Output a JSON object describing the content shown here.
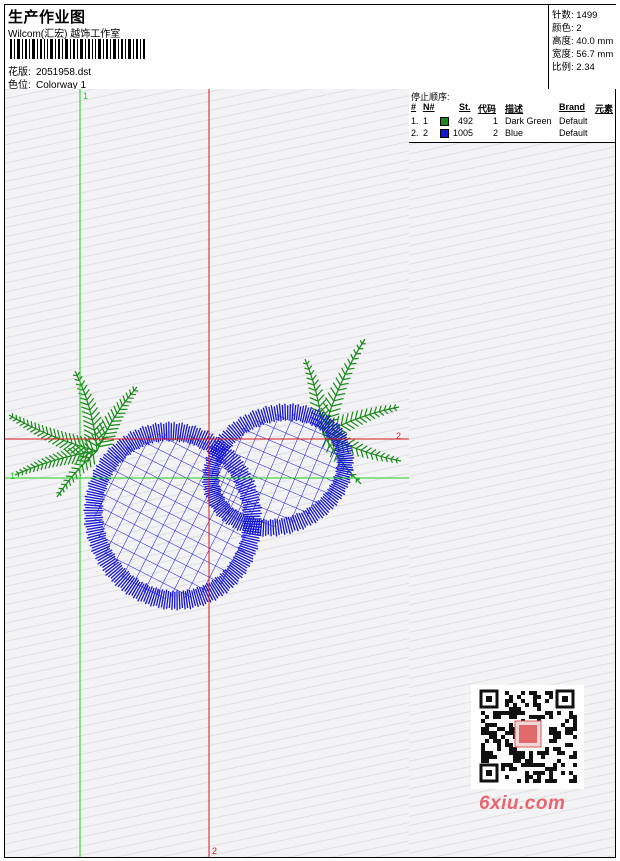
{
  "header": {
    "title": "生产作业图",
    "studio": "Wilcom(汇宏) 越饰工作室",
    "design_label": "花版:",
    "design_value": "2051958.dst",
    "colorway_label": "色位:",
    "colorway_value": "Colorway 1"
  },
  "stats": {
    "stitches_label": "针数:",
    "stitches_value": "1499",
    "colors_label": "颜色:",
    "colors_value": "2",
    "height_label": "高度:",
    "height_value": "40.0 mm",
    "width_label": "宽度:",
    "width_value": "56.7 mm",
    "scale_label": "比例:",
    "scale_value": "2.34"
  },
  "stop_sequence": {
    "title": "停止顺序:",
    "headers": [
      "#",
      "N#",
      "St.",
      "代码",
      "描述",
      "Brand",
      "元素"
    ],
    "rows": [
      {
        "index": "1.",
        "n": "1",
        "color": "#1a8a1a",
        "stitches": "492",
        "code": "1",
        "description": "Dark Green",
        "brand": "Default"
      },
      {
        "index": "2.",
        "n": "2",
        "color": "#1515d6",
        "stitches": "1005",
        "code": "2",
        "description": "Blue",
        "brand": "Default"
      }
    ]
  },
  "markers": {
    "green_top": "1",
    "green_left": "1",
    "red_right": "2",
    "red_bottom": "2"
  },
  "watermark": {
    "site": "6xiu.com"
  },
  "colors": {
    "green_guide": "#22cc22",
    "red_guide": "#d81818",
    "thread_green": "#1a8a1a",
    "thread_blue": "#1515d6"
  }
}
